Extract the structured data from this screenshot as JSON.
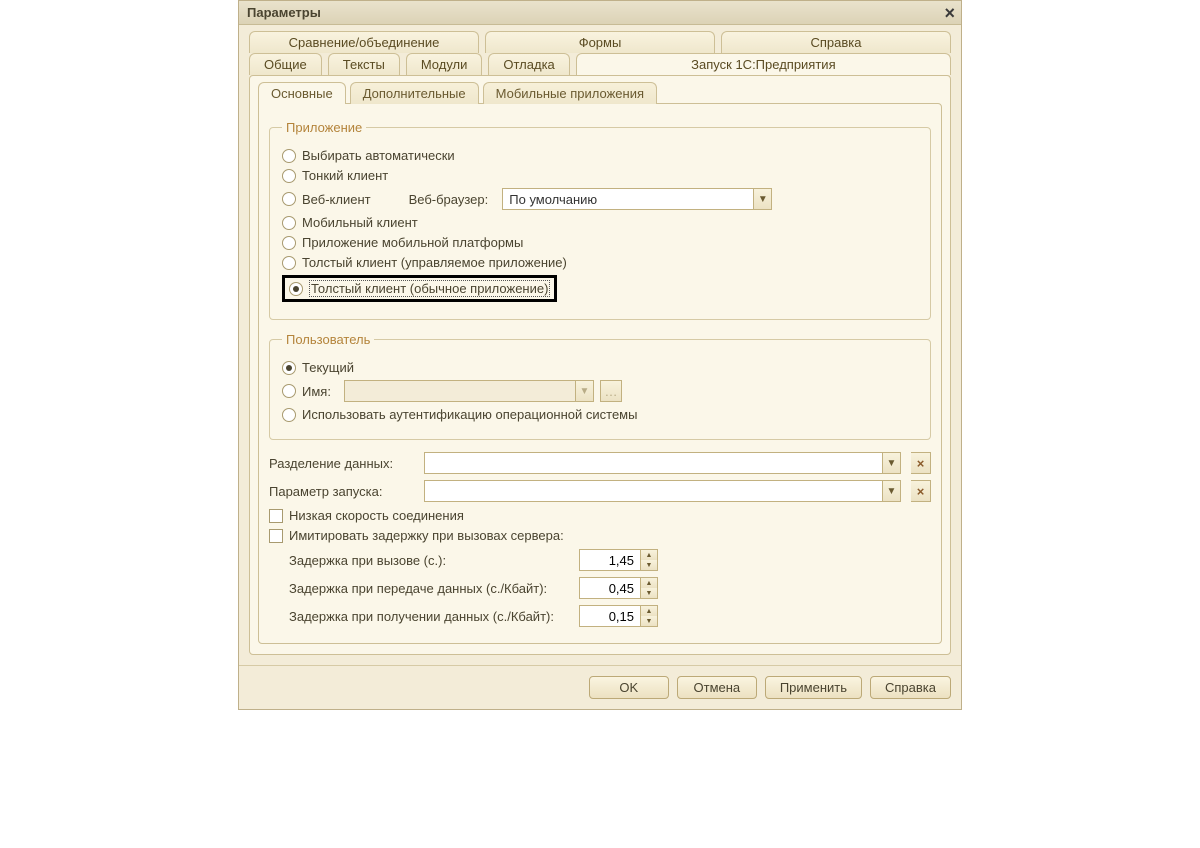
{
  "title": "Параметры",
  "tabs_top": [
    "Сравнение/объединение",
    "Формы",
    "Справка"
  ],
  "tabs_bottom": [
    "Общие",
    "Тексты",
    "Модули",
    "Отладка",
    "Запуск 1С:Предприятия"
  ],
  "subtabs": [
    "Основные",
    "Дополнительные",
    "Мобильные приложения"
  ],
  "groups": {
    "app": "Приложение",
    "user": "Пользователь"
  },
  "app_radios": {
    "auto": "Выбирать автоматически",
    "thin": "Тонкий клиент",
    "web": "Веб-клиент",
    "web_browser_label": "Веб-браузер:",
    "web_browser_value": "По умолчанию",
    "mobile": "Мобильный клиент",
    "mobile_platform": "Приложение мобильной платформы",
    "thick_managed": "Толстый клиент (управляемое приложение)",
    "thick_ordinary": "Толстый клиент (обычное приложение)"
  },
  "user_radios": {
    "current": "Текущий",
    "name": "Имя:",
    "os_auth": "Использовать аутентификацию операционной системы"
  },
  "fields": {
    "data_split": "Разделение данных:",
    "launch_param": "Параметр запуска:"
  },
  "checks": {
    "low_speed": "Низкая скорость соединения",
    "sim_delay": "Имитировать задержку при вызовах сервера:"
  },
  "delays": {
    "call": {
      "label": "Задержка при вызове (с.):",
      "value": "1,45"
    },
    "send": {
      "label": "Задержка при передаче данных (с./Кбайт):",
      "value": "0,45"
    },
    "recv": {
      "label": "Задержка при получении данных (с./Кбайт):",
      "value": "0,15"
    }
  },
  "buttons": {
    "ok": "OK",
    "cancel": "Отмена",
    "apply": "Применить",
    "help": "Справка"
  }
}
